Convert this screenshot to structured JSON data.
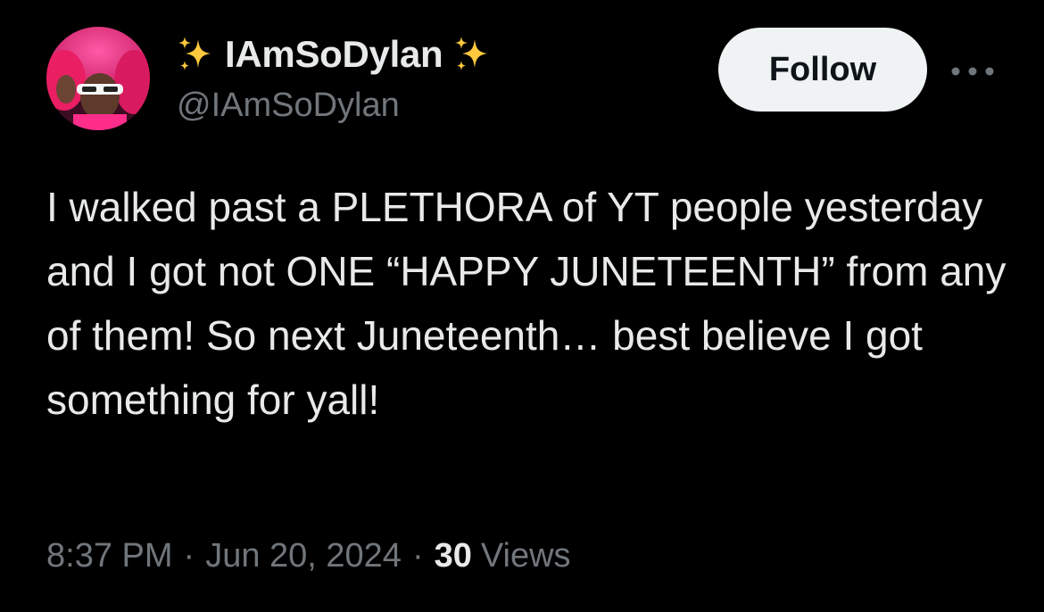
{
  "author": {
    "display_name": "IAmSoDylan",
    "handle": "@IAmSoDylan",
    "avatar": "profile-photo",
    "name_decoration": "sparkles-emoji"
  },
  "actions": {
    "follow_label": "Follow",
    "more_icon": "more-horizontal-icon"
  },
  "tweet": {
    "text": "I walked past a PLETHORA of YT people yesterday and I got not ONE “HAPPY JUNETEENTH” from any of them! So next Juneteenth… best believe I got something for yall!"
  },
  "meta": {
    "time": "8:37 PM",
    "separator": "·",
    "date": "Jun 20, 2024",
    "views_count": "30",
    "views_label": "Views"
  },
  "colors": {
    "background": "#000000",
    "text_primary": "#e7e9ea",
    "text_secondary": "#71767b",
    "follow_button_bg": "#eff3f4",
    "follow_button_text": "#0f1419",
    "sparkle": "#ffc83d"
  }
}
